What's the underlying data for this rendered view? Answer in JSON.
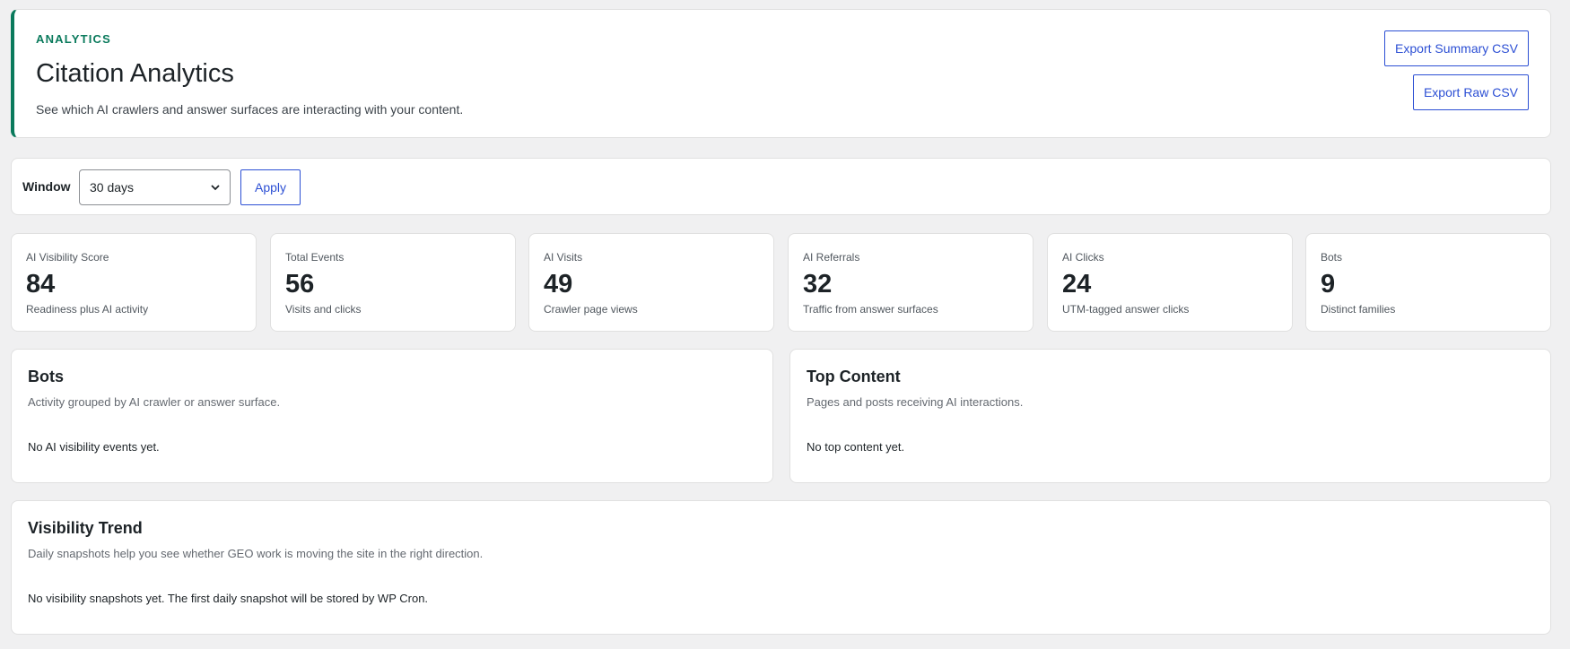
{
  "header": {
    "eyebrow": "ANALYTICS",
    "title": "Citation Analytics",
    "description": "See which AI crawlers and answer surfaces are interacting with your content.",
    "export_summary_label": "Export Summary CSV",
    "export_raw_label": "Export Raw CSV",
    "accent_color": "#0a7a5c"
  },
  "filter": {
    "label": "Window",
    "selected": "30 days",
    "apply_label": "Apply",
    "link_color": "#2c4fd4"
  },
  "stats": [
    {
      "label": "AI Visibility Score",
      "value": "84",
      "note": "Readiness plus AI activity"
    },
    {
      "label": "Total Events",
      "value": "56",
      "note": "Visits and clicks"
    },
    {
      "label": "AI Visits",
      "value": "49",
      "note": "Crawler page views"
    },
    {
      "label": "AI Referrals",
      "value": "32",
      "note": "Traffic from answer surfaces"
    },
    {
      "label": "AI Clicks",
      "value": "24",
      "note": "UTM-tagged answer clicks"
    },
    {
      "label": "Bots",
      "value": "9",
      "note": "Distinct families"
    }
  ],
  "bots": {
    "title": "Bots",
    "description": "Activity grouped by AI crawler or answer surface.",
    "empty": "No AI visibility events yet."
  },
  "top_content": {
    "title": "Top Content",
    "description": "Pages and posts receiving AI interactions.",
    "empty": "No top content yet."
  },
  "trend": {
    "title": "Visibility Trend",
    "description": "Daily snapshots help you see whether GEO work is moving the site in the right direction.",
    "empty": "No visibility snapshots yet. The first daily snapshot will be stored by WP Cron."
  }
}
